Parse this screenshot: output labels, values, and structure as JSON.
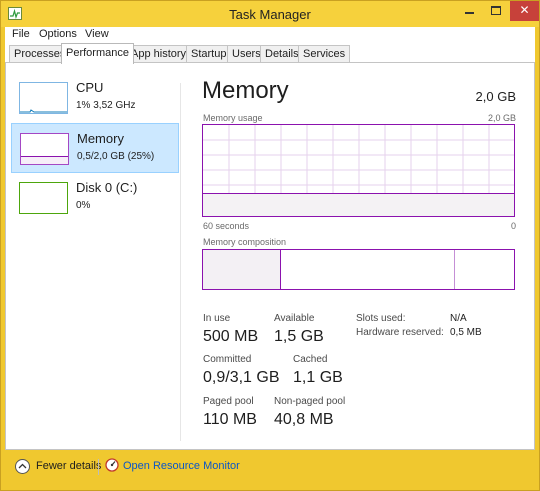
{
  "window": {
    "title": "Task Manager"
  },
  "menubar": {
    "items": [
      "File",
      "Options",
      "View"
    ]
  },
  "tabs": [
    {
      "label": "Processes",
      "active": false
    },
    {
      "label": "Performance",
      "active": true
    },
    {
      "label": "App history",
      "active": false
    },
    {
      "label": "Startup",
      "active": false
    },
    {
      "label": "Users",
      "active": false
    },
    {
      "label": "Details",
      "active": false
    },
    {
      "label": "Services",
      "active": false
    }
  ],
  "sidebar": {
    "items": [
      {
        "name": "CPU",
        "detail": "1%  3,52 GHz",
        "color": "#117dbb",
        "selected": false
      },
      {
        "name": "Memory",
        "detail": "0,5/2,0 GB (25%)",
        "color": "#8b12ae",
        "selected": true
      },
      {
        "name": "Disk 0 (C:)",
        "detail": "0%",
        "color": "#4da60c",
        "selected": false
      }
    ]
  },
  "memory": {
    "title": "Memory",
    "total": "2,0 GB",
    "usage_label": "Memory usage",
    "usage_max": "2,0 GB",
    "usage_fraction": 0.25,
    "time_span": "60 seconds",
    "axis_min": "0",
    "composition_label": "Memory composition",
    "composition": {
      "in_use_fraction": 0.25,
      "standby_end_fraction": 0.81
    },
    "stats": {
      "in_use": {
        "label": "In use",
        "value": "500 MB"
      },
      "available": {
        "label": "Available",
        "value": "1,5 GB"
      },
      "committed": {
        "label": "Committed",
        "value": "0,9/3,1 GB"
      },
      "cached": {
        "label": "Cached",
        "value": "1,1 GB"
      },
      "paged_pool": {
        "label": "Paged pool",
        "value": "110 MB"
      },
      "non_paged_pool": {
        "label": "Non-paged pool",
        "value": "40,8 MB"
      }
    },
    "details": {
      "slots_used": {
        "label": "Slots used:",
        "value": "N/A"
      },
      "hardware_reserved": {
        "label": "Hardware reserved:",
        "value": "0,5 MB"
      }
    }
  },
  "footer": {
    "fewer_details": "Fewer details",
    "open_monitor": "Open Resource Monitor"
  },
  "colors": {
    "memory_accent": "#8b12ae",
    "link": "#0b56c7",
    "selection": "#cce8ff"
  }
}
